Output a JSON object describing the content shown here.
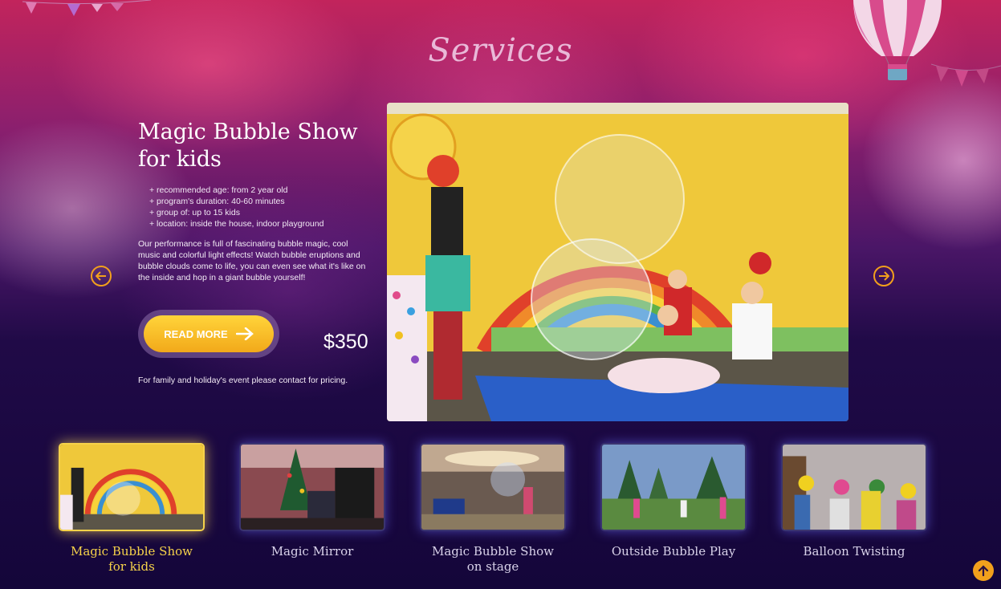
{
  "section_title": "Services",
  "active_service": {
    "title_line1": "Magic Bubble Show",
    "title_line2": "for kids",
    "features": [
      "+ recommended age: from 2 year old",
      "+ program's duration: 40-60 minutes",
      "+ group of: up to 15 kids",
      "+ location: inside the house, indoor playground"
    ],
    "description": "Our performance is full of fascinating bubble magic, cool music and colorful light effects! Watch bubble eruptions and bubble clouds come to life, you can even see what it's like on the inside and hop in a giant bubble yourself!",
    "read_more_label": "READ MORE",
    "price": "$350",
    "contact_note": "For family and holiday's event please contact for pricing."
  },
  "services": [
    {
      "line1": "Magic Bubble Show",
      "line2": "for kids",
      "active": true
    },
    {
      "line1": "Magic Mirror",
      "line2": "",
      "active": false
    },
    {
      "line1": "Magic Bubble Show",
      "line2": "on stage",
      "active": false
    },
    {
      "line1": "Outside Bubble Play",
      "line2": "",
      "active": false
    },
    {
      "line1": "Balloon Twisting",
      "line2": "",
      "active": false
    }
  ],
  "colors": {
    "accent": "#f2a01c",
    "active_label": "#f6d24a",
    "title": "#e9b9d8"
  },
  "icons": {
    "prev": "arrow-left-circle-icon",
    "next": "arrow-right-circle-icon",
    "read_more": "arrow-right-icon",
    "scroll_top": "arrow-up-circle-icon"
  }
}
